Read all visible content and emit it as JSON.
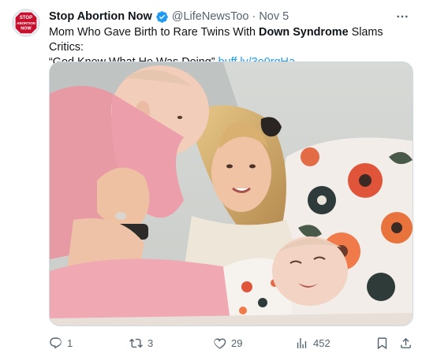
{
  "post": {
    "author": {
      "name": "Stop Abortion Now",
      "handle": "@LifeNewsToo",
      "verified": true,
      "avatar_text": [
        "STOP",
        "ABORTION",
        "NOW"
      ]
    },
    "separator": "·",
    "timestamp": "Nov 5",
    "text_part1": "Mom Who Gave Birth to Rare Twins With ",
    "text_bold": "Down Syndrome",
    "text_part2": " Slams Critics:",
    "text_line2": "“God Knew What He Was Doing” ",
    "link": "buff.ly/3o0rqHa",
    "media": {
      "description": "photo"
    },
    "actions": {
      "replies": "1",
      "reposts": "3",
      "likes": "29",
      "views": "452"
    }
  },
  "colors": {
    "accent": "#1d9bf0",
    "secondary_text": "#536471",
    "avatar_red": "#c8102e"
  },
  "icons": [
    "verified-badge-icon",
    "more-icon",
    "reply-icon",
    "repost-icon",
    "like-icon",
    "views-icon",
    "bookmark-icon",
    "share-icon"
  ]
}
